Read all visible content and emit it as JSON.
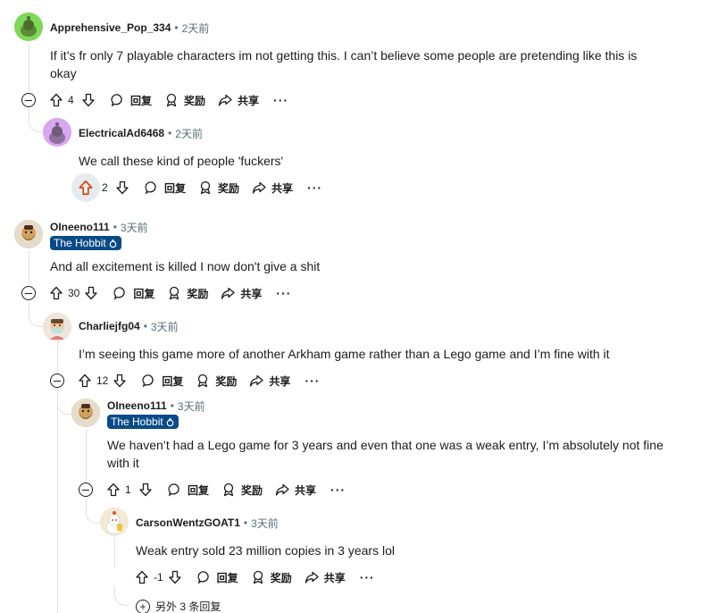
{
  "labels": {
    "reply": "回复",
    "award": "奖励",
    "share": "共享",
    "more": "···"
  },
  "comments": [
    {
      "username": "Apprehensive_Pop_334",
      "time": "2天前",
      "body": "If it’s fr only 7 playable characters im not getting this. I can’t believe some people are pretending like this is okay",
      "score": "4",
      "avatar_color": "#7ed957"
    },
    {
      "username": "ElectricalAd6468",
      "time": "2天前",
      "body": "We call these kind of people 'fuckers'",
      "score": "2",
      "upvoted": true,
      "avatar_color": "#c98de8"
    },
    {
      "username": "OIneeno111",
      "time": "3天前",
      "flair": "The Hobbit",
      "body": "And all excitement is killed I now don't give a shit",
      "score": "30",
      "avatar_color": "#c8b89a"
    },
    {
      "username": "Charliejfg04",
      "time": "3天前",
      "body": "I’m seeing this game more of another Arkham game rather than a Lego game and I’m fine with it",
      "score": "12",
      "avatar_color": "#d9c9b8"
    },
    {
      "username": "OIneeno111",
      "time": "3天前",
      "flair": "The Hobbit",
      "body": "We haven’t had a Lego game for 3 years and even that one was a weak entry, I’m absolutely not fine with it",
      "score": "1",
      "avatar_color": "#c8b89a"
    },
    {
      "username": "CarsonWentzGOAT1",
      "time": "3天前",
      "body": "Weak entry sold 23 million copies in 3 years lol",
      "score": "-1",
      "avatar_color": "#e8dcc0"
    }
  ],
  "more_replies": "另外 3 条回复",
  "colors": {
    "upvote_active": "#d93a00",
    "flair_bg": "#0a4b87",
    "thread_line": "#dfe1e4"
  }
}
